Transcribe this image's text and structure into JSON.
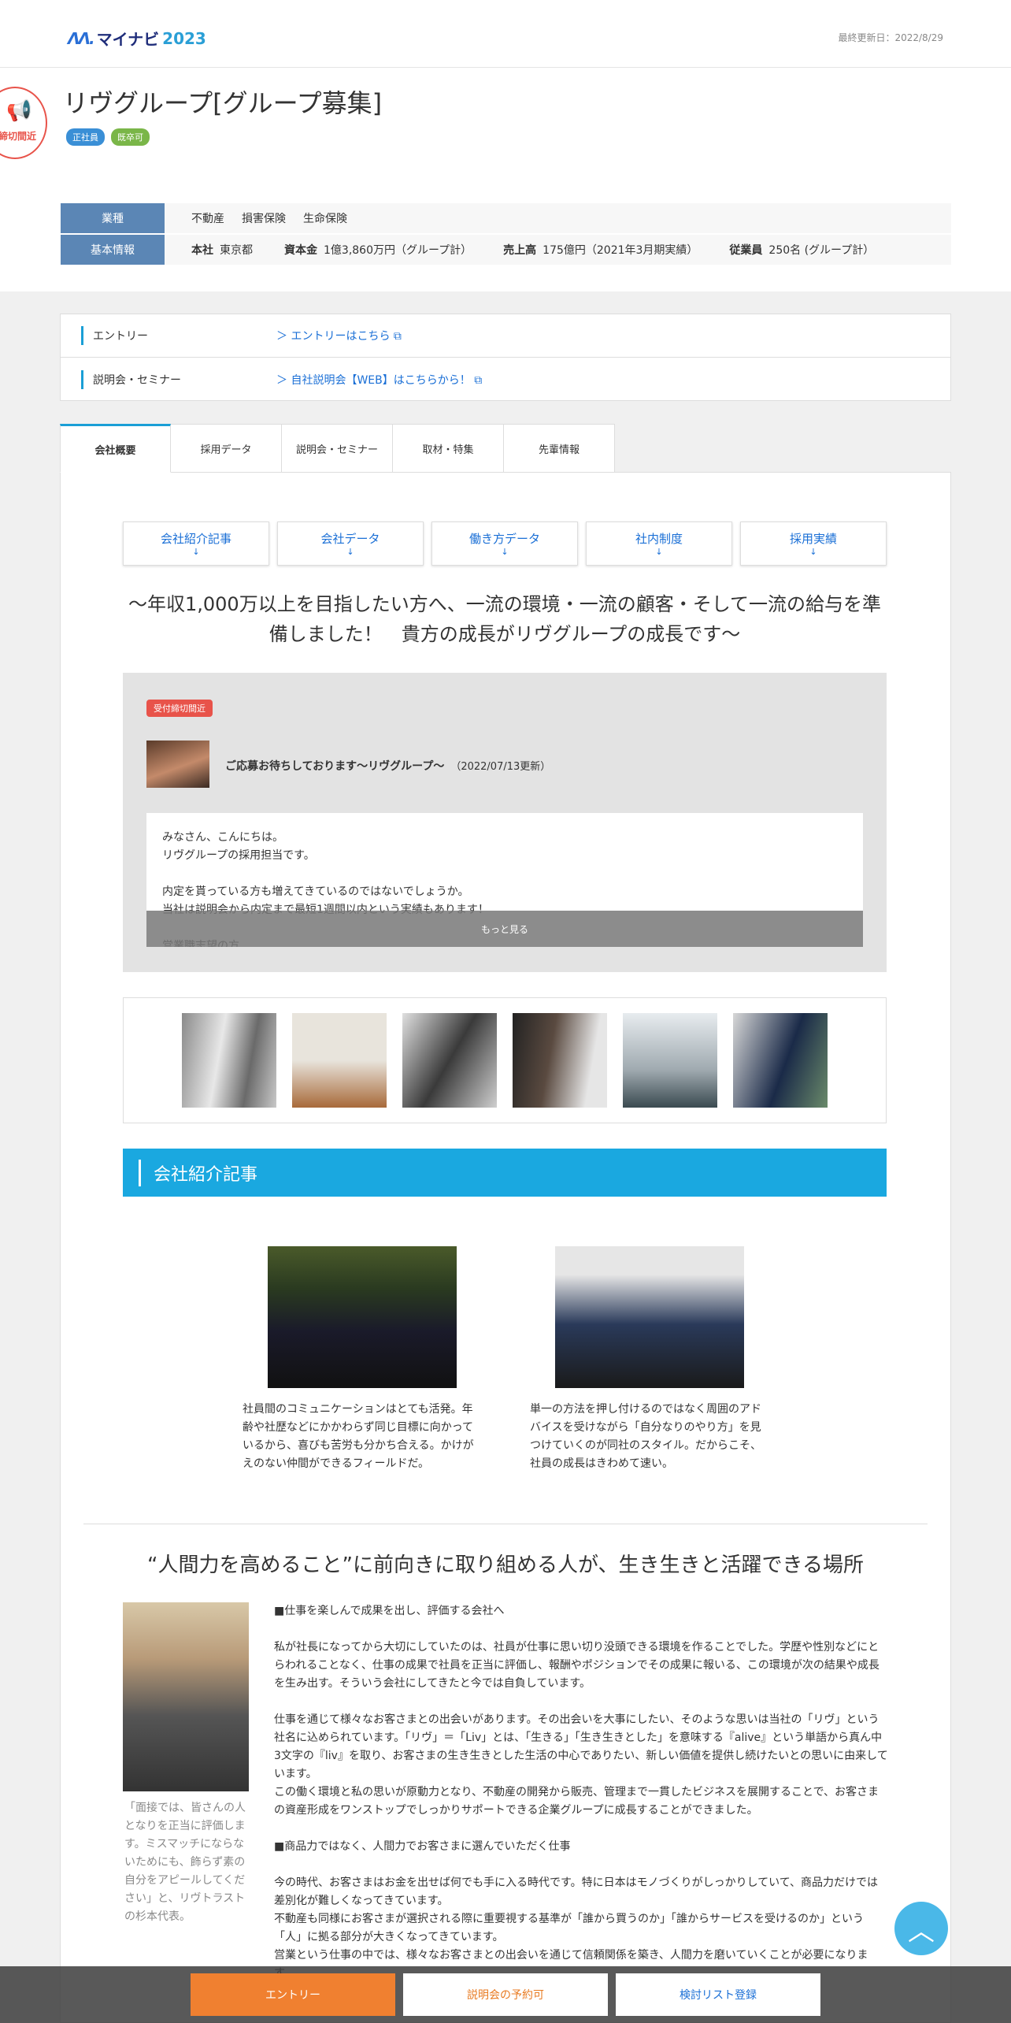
{
  "header": {
    "logo_mark": "ɅɅ.",
    "logo_name": "マイナビ",
    "logo_year": "2023",
    "updated": "最終更新日：2022/8/29",
    "stamp": "締切間近",
    "company": "リヴグループ[グループ募集]",
    "tags": [
      "正社員",
      "既卒可"
    ]
  },
  "info": {
    "industry_label": "業種",
    "industries": [
      "不動産",
      "損害保険",
      "生命保険"
    ],
    "basic_label": "基本情報",
    "hq_key": "本社",
    "hq_val": "東京都",
    "capital_key": "資本金",
    "capital_val": "1億3,860万円（グループ計）",
    "sales_key": "売上高",
    "sales_val": "175億円（2021年3月期実績）",
    "emp_key": "従業員",
    "emp_val": "250名 (グループ計）"
  },
  "links": {
    "entry_label": "エントリー",
    "entry_link": "＞ エントリーはこちら ⧉",
    "seminar_label": "説明会・セミナー",
    "seminar_link": "＞ 自社説明会【WEB】はこちらから！ ⧉"
  },
  "tabs": [
    "会社概要",
    "採用データ",
    "説明会・セミナー",
    "取材・特集",
    "先輩情報"
  ],
  "pills": [
    "会社紹介記事",
    "会社データ",
    "働き方データ",
    "社内制度",
    "採用実績"
  ],
  "pill_arrow": "↓",
  "catch": "～年収1,000万以上を目指したい方へ、一流の環境・一流の顧客・そして一流の給与を準備しました！　貴方の成長がリヴグループの成長です～",
  "message": {
    "badge": "受付締切間近",
    "title": "ご応募お待ちしております～リヴグループ～",
    "date": "（2022/07/13更新）",
    "text": "みなさん、こんにちは。\nリヴグループの採用担当です。\n\n内定を貰っている方も増えてきているのではないでしょうか。\n当社は説明会から内定まで最短1週間以内という実績もあります！\n\n営業職志望の方",
    "more": "もっと見る"
  },
  "section_title": "会社紹介記事",
  "articles": [
    "社員間のコミュニケーションはとても活発。年齢や社歴などにかかわらず同じ目標に向かっているから、喜びも苦労も分かち合える。かけがえのない仲間ができるフィールドだ。",
    "単一の方法を押し付けるのではなく周囲のアドバイスを受けながら「自分なりのやり方」を見つけていくのが同社のスタイル。だからこそ、社員の成長はきわめて速い。"
  ],
  "headline": "“人間力を高めること”に前向きに取り組める人が、生き生きと活躍できる場所",
  "ceo_caption": "「面接では、皆さんの人となりを正当に評価します。ミスマッチにならないためにも、飾らず素の自分をアピールしてください」と、リヴトラストの杉本代表。",
  "body": "■仕事を楽しんで成果を出し、評価する会社へ\n\n私が社長になってから大切にしていたのは、社員が仕事に思い切り没頭できる環境を作ることでした。学歴や性別などにとらわれることなく、仕事の成果で社員を正当に評価し、報酬やポジションでその成果に報いる、この環境が次の結果や成長を生み出す。そういう会社にしてきたと今では自負しています。\n\n仕事を通じて様々なお客さまとの出会いがあります。その出会いを大事にしたい、そのような思いは当社の「リヴ」という社名に込められています。「リヴ」＝「Liv」とは、「生きる」「生き生きとした」を意味する『alive』という単語から真ん中3文字の『liv』を取り、お客さまの生き生きとした生活の中心でありたい、新しい価値を提供し続けたいとの思いに由来しています。\nこの働く環境と私の思いが原動力となり、不動産の開発から販売、管理まで一貫したビジネスを展開することで、お客さまの資産形成をワンストップでしっかりサポートできる企業グループに成長することができました。\n\n■商品力ではなく、人間力でお客さまに選んでいただく仕事\n\n今の時代、お客さまはお金を出せば何でも手に入る時代です。特に日本はモノづくりがしっかりしていて、商品力だけでは差別化が難しくなってきています。\n不動産も同様にお客さまが選択される際に重要視する基準が「誰から買うのか」「誰からサービスを受けるのか」という「人」に拠る部分が大きくなってきています。\n営業という仕事の中では、様々なお客さまとの出会いを通じて信頼関係を築き、人間力を磨いていくことが必要になります。",
  "bottom": {
    "entry": "エントリー",
    "seminar": "説明会の予約可",
    "list": "検討リスト登録"
  },
  "top_icon": "︿"
}
